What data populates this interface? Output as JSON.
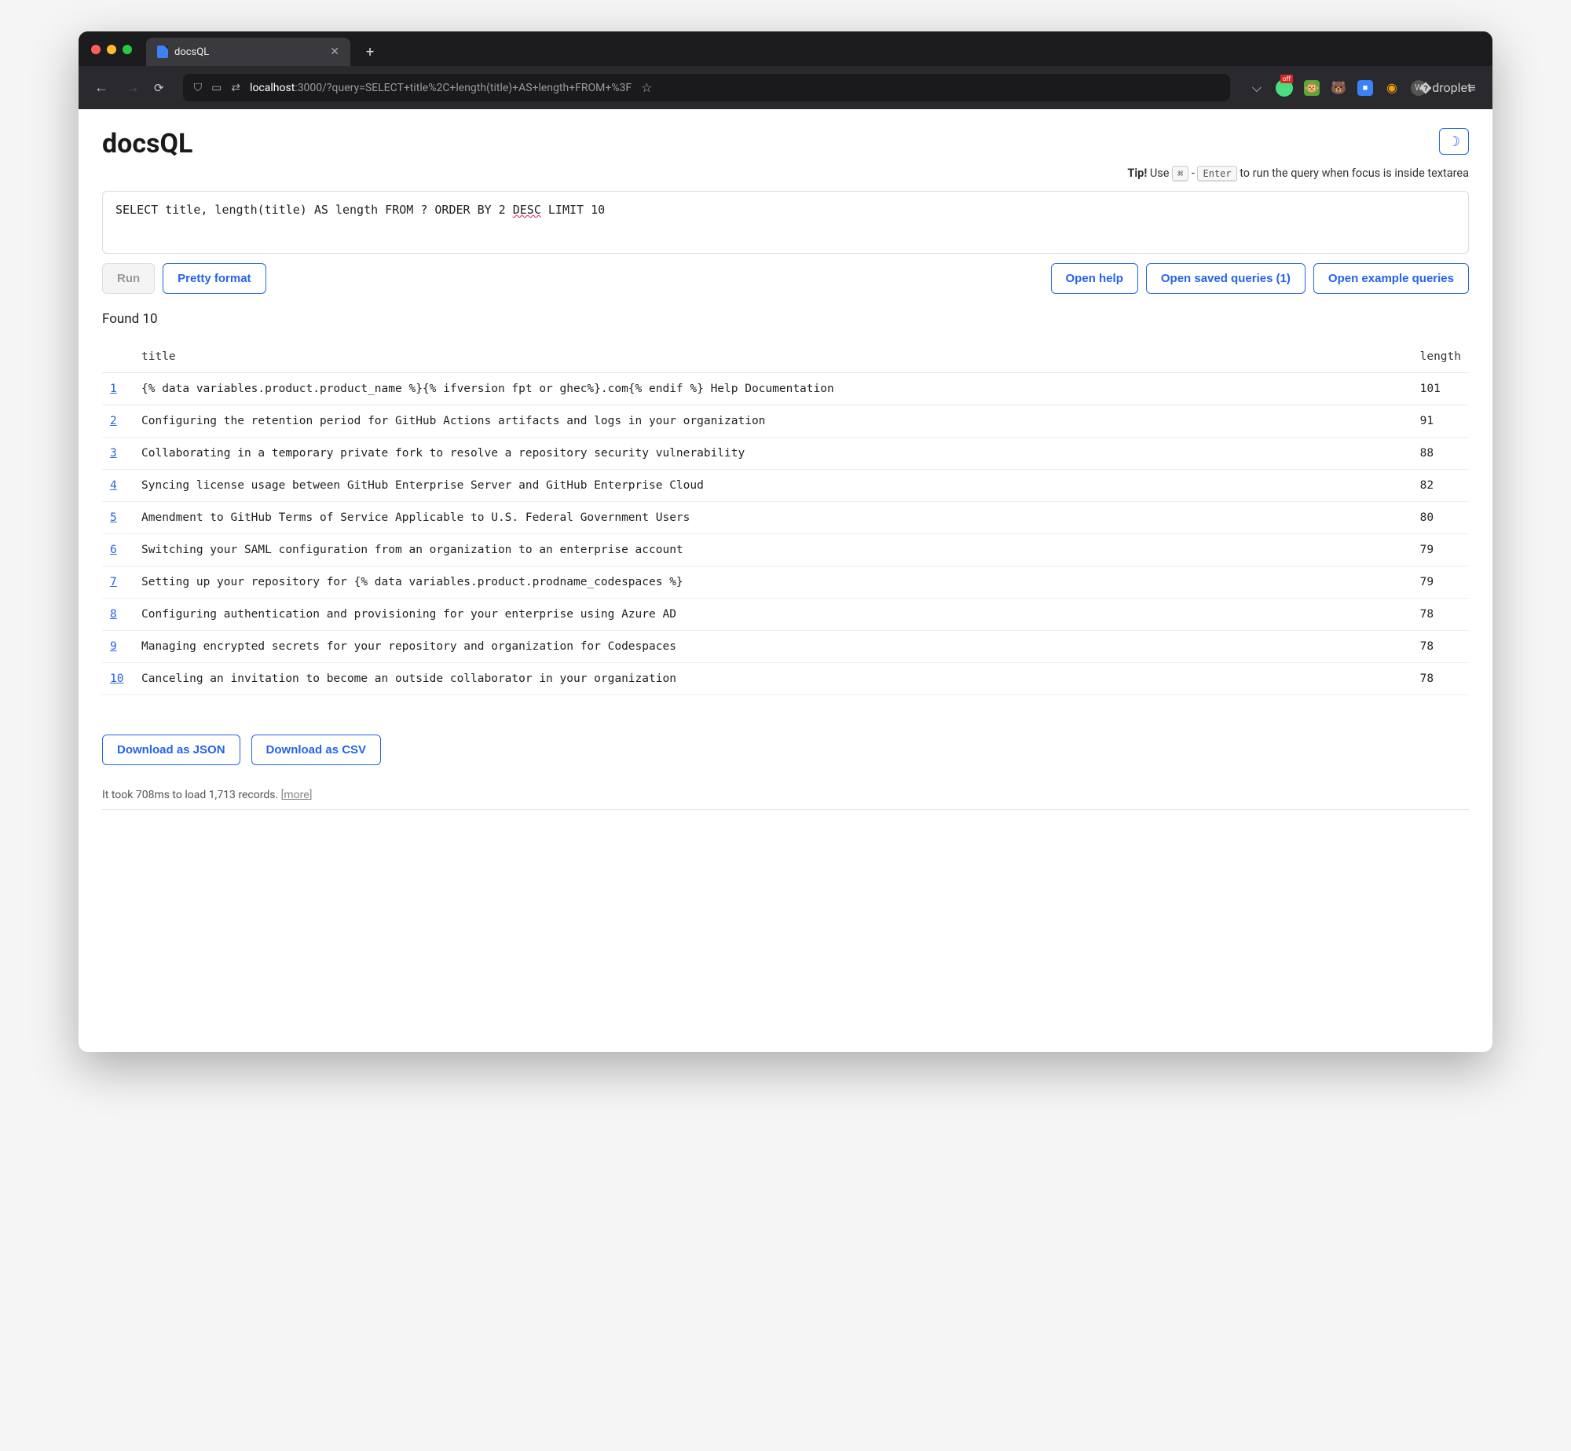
{
  "browser": {
    "tab_title": "docsQL",
    "url_host": "localhost",
    "url_port_path": ":3000/?query=SELECT+title%2C+length(title)+AS+length+FROM+%3F"
  },
  "page": {
    "title": "docsQL",
    "tip_prefix": "Tip!",
    "tip_use": " Use ",
    "tip_key1": "⌘",
    "tip_dash": " - ",
    "tip_key2": "Enter",
    "tip_suffix": " to run the query when focus is inside textarea",
    "sql_prefix": "SELECT title, length(title) AS length FROM ? ORDER BY 2 ",
    "sql_wavy": "DESC",
    "sql_suffix": " LIMIT 10",
    "buttons": {
      "run": "Run",
      "pretty": "Pretty format",
      "help": "Open help",
      "saved": "Open saved queries (1)",
      "examples": "Open example queries"
    },
    "found": "Found 10",
    "columns": {
      "title": "title",
      "length": "length"
    },
    "rows": [
      {
        "n": "1",
        "title": "{% data variables.product.product_name %}{% ifversion fpt or ghec%}.com{% endif %} Help Documentation",
        "length": "101"
      },
      {
        "n": "2",
        "title": "Configuring the retention period for GitHub Actions artifacts and logs in your organization",
        "length": "91"
      },
      {
        "n": "3",
        "title": "Collaborating in a temporary private fork to resolve a repository security vulnerability",
        "length": "88"
      },
      {
        "n": "4",
        "title": "Syncing license usage between GitHub Enterprise Server and GitHub Enterprise Cloud",
        "length": "82"
      },
      {
        "n": "5",
        "title": "Amendment to GitHub Terms of Service Applicable to U.S. Federal Government Users",
        "length": "80"
      },
      {
        "n": "6",
        "title": "Switching your SAML configuration from an organization to an enterprise account",
        "length": "79"
      },
      {
        "n": "7",
        "title": "Setting up your repository for {% data variables.product.prodname_codespaces %}",
        "length": "79"
      },
      {
        "n": "8",
        "title": "Configuring authentication and provisioning for your enterprise using Azure AD",
        "length": "78"
      },
      {
        "n": "9",
        "title": "Managing encrypted secrets for your repository and organization for Codespaces",
        "length": "78"
      },
      {
        "n": "10",
        "title": "Canceling an invitation to become an outside collaborator in your organization",
        "length": "78"
      }
    ],
    "download_json": "Download as JSON",
    "download_csv": "Download as CSV",
    "footer": "It took 708ms to load 1,713 records. ",
    "footer_more": "more"
  }
}
